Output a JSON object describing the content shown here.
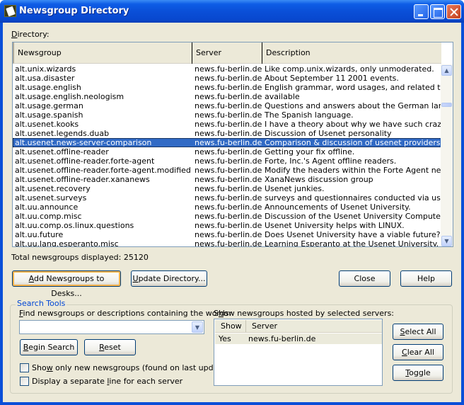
{
  "window": {
    "title": "Newsgroup Directory",
    "controls": {
      "minimize": "minimize-icon",
      "maximize": "maximize-icon",
      "close": "close-icon"
    }
  },
  "directory": {
    "label_prefix": "D",
    "label_rest": "irectory:",
    "columns": [
      "Newsgroup",
      "Server",
      "Description"
    ],
    "selected_index": 8,
    "rows": [
      {
        "newsgroup": "alt.unix.wizards",
        "server": "news.fu-berlin.de",
        "description": "Like comp.unix.wizards, only unmoderated."
      },
      {
        "newsgroup": "alt.usa.disaster",
        "server": "news.fu-berlin.de",
        "description": "About September 11 2001 events."
      },
      {
        "newsgroup": "alt.usage.english",
        "server": "news.fu-berlin.de",
        "description": "English grammar, word usages, and related topics."
      },
      {
        "newsgroup": "alt.usage.english.neologism",
        "server": "news.fu-berlin.de",
        "description": "available"
      },
      {
        "newsgroup": "alt.usage.german",
        "server": "news.fu-berlin.de",
        "description": "Questions and answers about the German language"
      },
      {
        "newsgroup": "alt.usage.spanish",
        "server": "news.fu-berlin.de",
        "description": "The Spanish language."
      },
      {
        "newsgroup": "alt.usenet.kooks",
        "server": "news.fu-berlin.de",
        "description": "I have a theory about why we have such crazy the"
      },
      {
        "newsgroup": "alt.usenet.legends.duab",
        "server": "news.fu-berlin.de",
        "description": "Discussion of Usenet personality"
      },
      {
        "newsgroup": "alt.usenet.news-server-comparison",
        "server": "news.fu-berlin.de",
        "description": "Comparison & discussion of usenet providers."
      },
      {
        "newsgroup": "alt.usenet.offline-reader",
        "server": "news.fu-berlin.de",
        "description": "Getting your fix offline."
      },
      {
        "newsgroup": "alt.usenet.offline-reader.forte-agent",
        "server": "news.fu-berlin.de",
        "description": "Forte, Inc.'s Agent offline readers."
      },
      {
        "newsgroup": "alt.usenet.offline-reader.forte-agent.modified",
        "server": "news.fu-berlin.de",
        "description": "Modify the headers within the Forte Agent news re"
      },
      {
        "newsgroup": "alt.usenet.offline-reader.xananews",
        "server": "news.fu-berlin.de",
        "description": "XanaNews discussion group"
      },
      {
        "newsgroup": "alt.usenet.recovery",
        "server": "news.fu-berlin.de",
        "description": "Usenet junkies."
      },
      {
        "newsgroup": "alt.usenet.surveys",
        "server": "news.fu-berlin.de",
        "description": "surveys and questionnaires conducted via usenet"
      },
      {
        "newsgroup": "alt.uu.announce",
        "server": "news.fu-berlin.de",
        "description": "Announcements of Usenet University."
      },
      {
        "newsgroup": "alt.uu.comp.misc",
        "server": "news.fu-berlin.de",
        "description": "Discussion of the Usenet University Computer Depa"
      },
      {
        "newsgroup": "alt.uu.comp.os.linux.questions",
        "server": "news.fu-berlin.de",
        "description": "Usenet University helps with LINUX."
      },
      {
        "newsgroup": "alt.uu.future",
        "server": "news.fu-berlin.de",
        "description": "Does Usenet University have a viable future?"
      },
      {
        "newsgroup": "alt.uu.lang.esperanto.misc",
        "server": "news.fu-berlin.de",
        "description": "Learning Esperanto at the Usenet University."
      }
    ],
    "scrollbar": {
      "up": "scroll-up-icon",
      "down": "scroll-down-icon"
    }
  },
  "total_label": "Total newsgroups displayed: 25120",
  "buttons": {
    "add": {
      "accel": "A",
      "rest": "dd Newsgroups to Desks..."
    },
    "update": {
      "accel": "U",
      "rest": "pdate Directory..."
    },
    "close": "Close",
    "help": "Help"
  },
  "search_tools": {
    "title": "Search Tools",
    "find_label_accel": "F",
    "find_label_rest": "ind newsgroups or descriptions containing the words:",
    "find_value": "",
    "begin_search": {
      "accel": "B",
      "rest": "egin Search"
    },
    "reset": {
      "accel": "R",
      "rest": "eset"
    },
    "checkbox_new": {
      "pre": "Sho",
      "accel": "w",
      "post": " only new newsgroups (found on last update)",
      "checked": false
    },
    "checkbox_separate": {
      "pre": "Display a separate ",
      "accel": "l",
      "post": "ine for each server",
      "checked": false
    },
    "servers_label_pre": "S",
    "servers_label_accel": "h",
    "servers_label_post": "ow newsgroups hosted by selected servers:",
    "servers_columns": [
      "Show",
      "Server"
    ],
    "servers_rows": [
      {
        "show": "Yes",
        "server": "news.fu-berlin.de"
      }
    ],
    "select_all": {
      "accel": "S",
      "rest": "elect All"
    },
    "clear_all": {
      "accel": "C",
      "rest": "lear All"
    },
    "toggle": {
      "accel": "T",
      "rest": "oggle"
    }
  }
}
